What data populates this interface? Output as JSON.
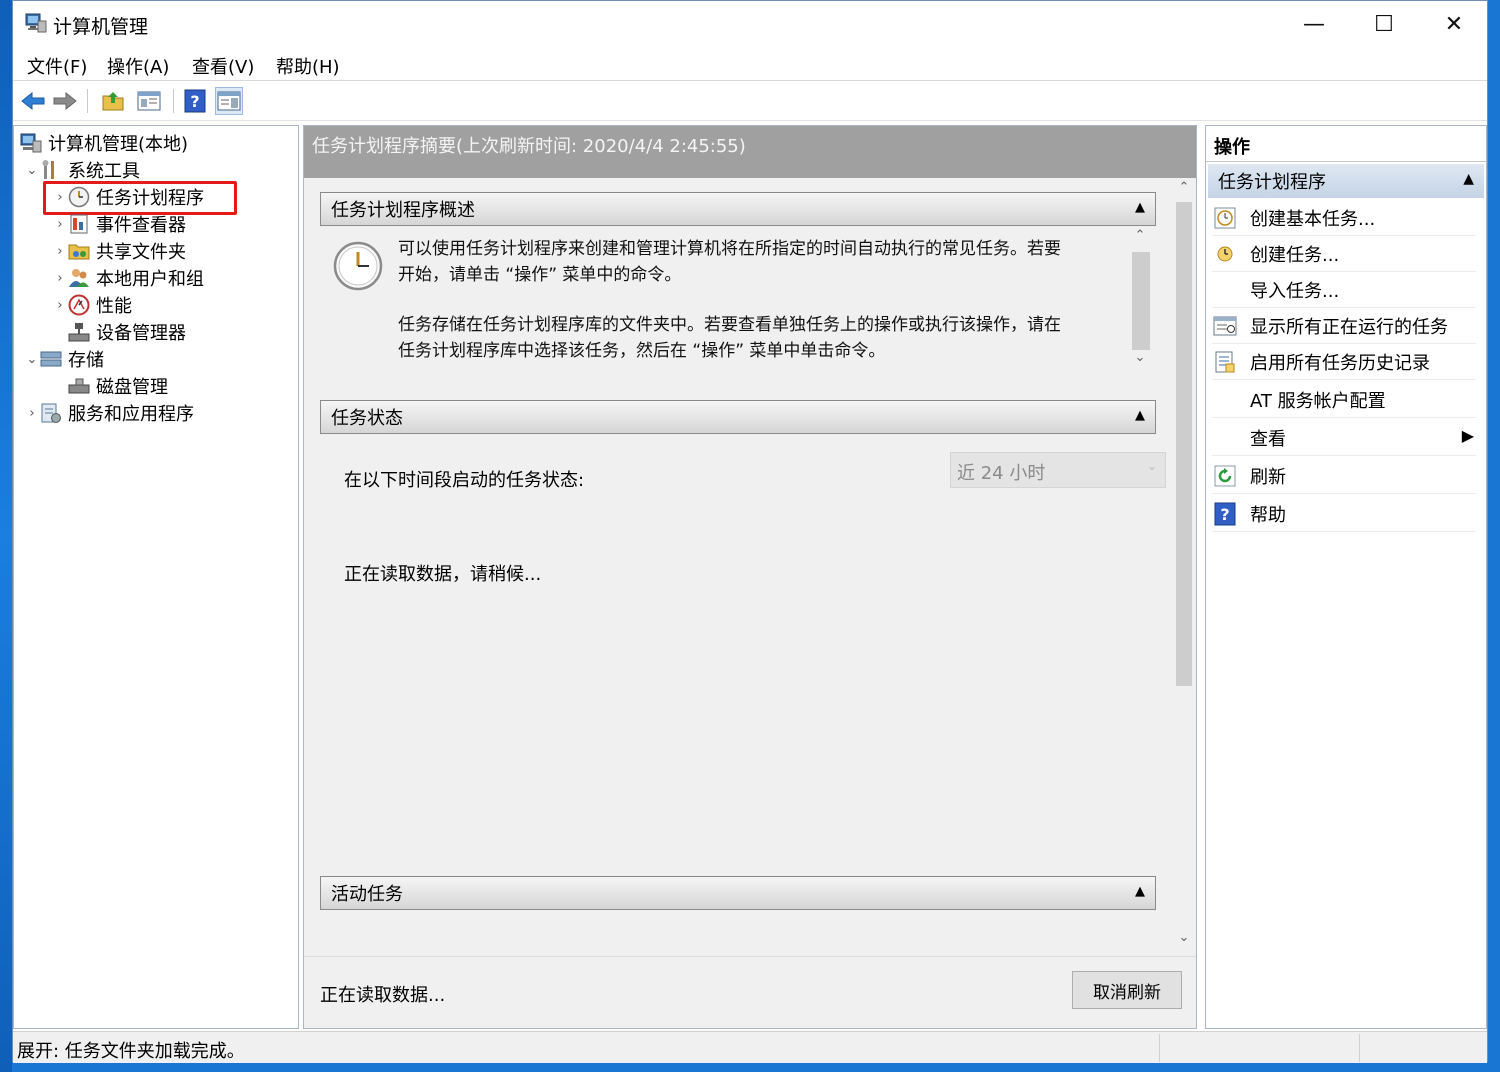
{
  "window": {
    "title": "计算机管理",
    "controls": {
      "minimize": "—",
      "maximize": "☐",
      "close": "✕"
    }
  },
  "menu": [
    "文件(F)",
    "操作(A)",
    "查看(V)",
    "帮助(H)"
  ],
  "toolbar": {
    "icons": [
      "back-arrow-icon",
      "forward-arrow-icon",
      "up-folder-icon",
      "show-hide-tree-icon",
      "help-icon",
      "action-pane-icon"
    ]
  },
  "tree": {
    "root": "计算机管理(本地)",
    "system_tools": "系统工具",
    "task_scheduler": "任务计划程序",
    "event_viewer": "事件查看器",
    "shared_folders": "共享文件夹",
    "local_users": "本地用户和组",
    "performance": "性能",
    "device_manager": "设备管理器",
    "storage": "存储",
    "disk_management": "磁盘管理",
    "services_apps": "服务和应用程序"
  },
  "center": {
    "summary_title": "任务计划程序摘要(上次刷新时间: 2020/4/4 2:45:55)",
    "overview": {
      "title": "任务计划程序概述",
      "para1_line1": "可以使用任务计划程序来创建和管理计算机将在所指定的时间自动执行的常见任务。若要",
      "para1_line2": "开始，请单击 “操作” 菜单中的命令。",
      "para2_line1": "任务存储在任务计划程序库的文件夹中。若要查看单独任务上的操作或执行该操作，请在",
      "para2_line2": "任务计划程序库中选择该任务，然后在 “操作” 菜单中单击命令。"
    },
    "status": {
      "title": "任务状态",
      "period_label": "在以下时间段启动的任务状态:",
      "period_value": "近 24 小时",
      "loading": "正在读取数据，请稍候..."
    },
    "active": {
      "title": "活动任务"
    },
    "bottom_status": "正在读取数据...",
    "cancel_refresh": "取消刷新"
  },
  "actions": {
    "header": "操作",
    "section": "任务计划程序",
    "items": [
      {
        "label": "创建基本任务...",
        "icon": "create-basic-task-icon"
      },
      {
        "label": "创建任务...",
        "icon": "create-task-icon"
      },
      {
        "label": "导入任务...",
        "icon": ""
      },
      {
        "label": "显示所有正在运行的任务",
        "icon": "running-tasks-icon"
      },
      {
        "label": "启用所有任务历史记录",
        "icon": "task-history-icon"
      },
      {
        "label": "AT 服务帐户配置",
        "icon": ""
      },
      {
        "label": "查看",
        "icon": ""
      },
      {
        "label": "刷新",
        "icon": "refresh-icon"
      },
      {
        "label": "帮助",
        "icon": "help-icon"
      }
    ]
  },
  "statusbar": {
    "text": "展开: 任务文件夹加载完成。"
  },
  "colors": {
    "highlight": "#e51a1a",
    "summary_bg": "#a0a0a0",
    "actions_section_bg": "#c4d3e5"
  }
}
